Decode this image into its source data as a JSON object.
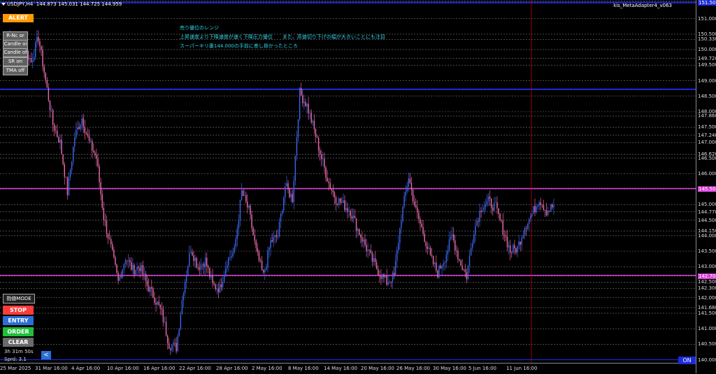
{
  "title": {
    "symbol": "USDJPY,H4",
    "ohlc": "144.873 145.031 144.725 144.959"
  },
  "indicator_name": "kis_MetaAdapter4_v063",
  "notes": [
    "売り優位のレンジ",
    "上昇速度より下降速度が速く下降圧力優位　　また、高値切り下げの幅が大きいことにも注目",
    "スーパーキリ番144.000の手前に差し掛かったところ"
  ],
  "buttons": {
    "alert": "ALERT",
    "mode": "指値MODE",
    "stop": "STOP",
    "entry": "ENTRY",
    "order": "ORDER",
    "clear": "CLEAR",
    "on": "ON",
    "back": "<"
  },
  "side_buttons": [
    "R-Nc or",
    "Candle oi",
    "Candle of",
    "SR on",
    "TMA off"
  ],
  "status": {
    "timer": "3h 31m 50s",
    "spread": "Sprd: 3.1"
  },
  "colors": {
    "stop": "#ff3b3b",
    "entry": "#2b6fd6",
    "order": "#1fbf3a",
    "clear": "#6a6a6a",
    "bull": "#3a64e8",
    "bear": "#e86aa8",
    "hline_blue": "#1c2bd8",
    "hline_magenta": "#d640d6",
    "vline": "#c00000"
  },
  "price_axis": {
    "labels": [
      "151.570",
      "151.500",
      "151.000",
      "150.500",
      "150.330",
      "150.000",
      "149.720",
      "149.500",
      "149.000",
      "148.500",
      "148.000",
      "147.860",
      "147.500",
      "147.240",
      "147.000",
      "146.620",
      "146.500",
      "146.000",
      "145.500",
      "145.000",
      "144.770",
      "144.500",
      "144.150",
      "144.000",
      "143.500",
      "143.000",
      "142.700",
      "142.500",
      "142.300",
      "142.000",
      "141.680",
      "141.500",
      "141.000",
      "140.500",
      "140.000"
    ],
    "highlighted_magenta": [
      "145.500",
      "142.700"
    ],
    "highlighted_blue": [
      "151.500"
    ]
  },
  "time_axis": {
    "labels": [
      "25 Mar 2025",
      "31 Mar 16:00",
      "4 Apr 16:00",
      "10 Apr 16:00",
      "16 Apr 16:00",
      "22 Apr 16:00",
      "28 Apr 16:00",
      "2 May 16:00",
      "8 May 16:00",
      "14 May 16:00",
      "20 May 16:00",
      "26 May 16:00",
      "30 May 16:00",
      "5 Jun 16:00",
      "11 Jun 16:00"
    ]
  },
  "horizontal_lines": {
    "blue": [
      151.52,
      148.72
    ],
    "magenta": [
      145.52,
      142.72
    ],
    "bottom_blue": [
      140.0
    ]
  },
  "chart_data": {
    "type": "candlestick",
    "symbol": "USDJPY",
    "timeframe": "H4",
    "ylim": [
      139.9,
      151.6
    ],
    "x": [
      "25 Mar 2025",
      "31 Mar 16:00",
      "4 Apr 16:00",
      "10 Apr 16:00",
      "16 Apr 16:00",
      "22 Apr 16:00",
      "28 Apr 16:00",
      "2 May 16:00",
      "8 May 16:00",
      "14 May 16:00",
      "20 May 16:00",
      "26 May 16:00",
      "30 May 16:00",
      "5 Jun 16:00",
      "11 Jun 16:00"
    ],
    "close_path": [
      150.2,
      150.5,
      149.4,
      150.1,
      149.6,
      150.4,
      149.0,
      147.6,
      147.0,
      145.4,
      147.2,
      147.8,
      147.0,
      146.5,
      144.6,
      143.6,
      142.5,
      143.3,
      142.9,
      143.0,
      142.4,
      142.0,
      141.5,
      140.5,
      140.4,
      142.3,
      143.6,
      143.0,
      143.2,
      142.4,
      142.3,
      143.2,
      143.5,
      145.4,
      144.8,
      143.5,
      142.7,
      143.8,
      144.0,
      145.6,
      145.2,
      148.6,
      148.2,
      147.4,
      146.5,
      145.7,
      145.2,
      145.0,
      144.8,
      144.2,
      143.7,
      143.2,
      142.8,
      142.5,
      142.7,
      144.6,
      145.9,
      144.8,
      144.1,
      143.3,
      142.8,
      143.3,
      144.0,
      143.2,
      142.7,
      144.2,
      144.9,
      145.1,
      144.9,
      144.2,
      143.5,
      143.6,
      144.3,
      144.7,
      145.2,
      144.8,
      144.959
    ]
  }
}
